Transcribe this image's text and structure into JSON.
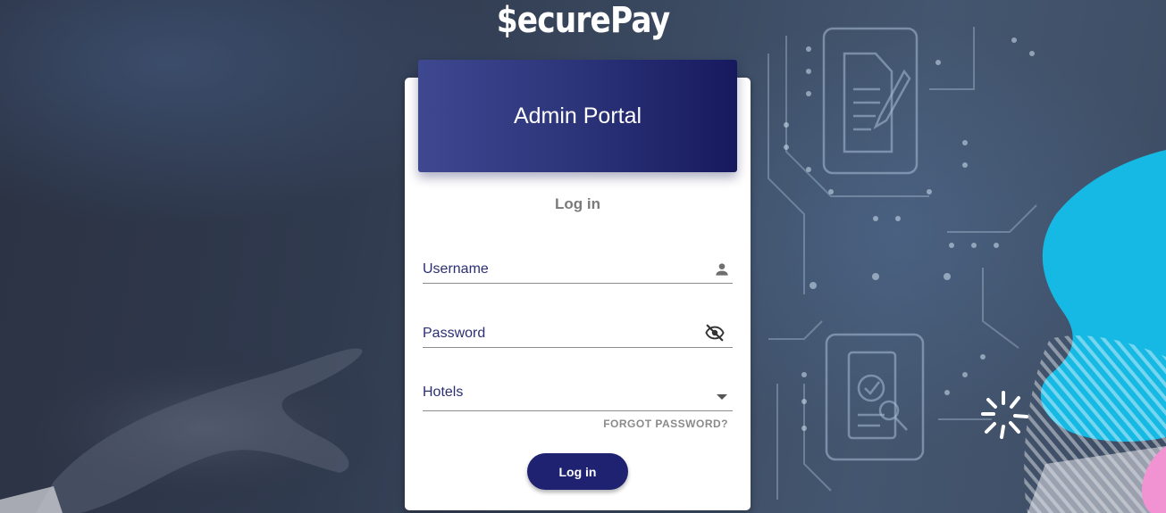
{
  "brand": {
    "name": "$ecurePay"
  },
  "card": {
    "header_title": "Admin Portal",
    "section_title": "Log in"
  },
  "form": {
    "username_label": "Username",
    "password_label": "Password",
    "hotels_label": "Hotels",
    "forgot_password": "FORGOT PASSWORD?",
    "login_button": "Log in"
  },
  "icons": {
    "username": "person-icon",
    "password": "visibility-off-icon",
    "hotels": "dropdown-arrow-icon"
  },
  "colors": {
    "header_gradient_start": "#3e4890",
    "header_gradient_end": "#17195e",
    "button": "#1e2270",
    "label": "#2b2f72",
    "accent_cyan": "#16b9e3",
    "accent_pink": "#ff2fb3"
  }
}
